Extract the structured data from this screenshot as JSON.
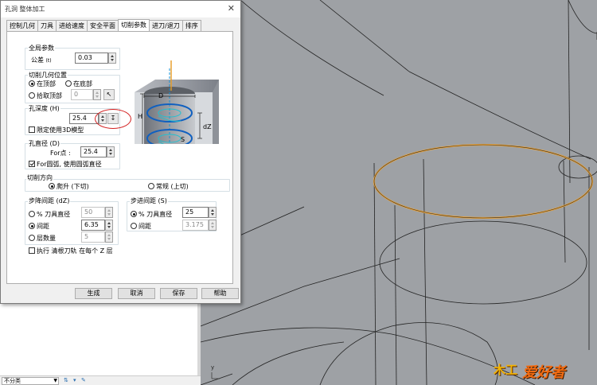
{
  "dialog": {
    "title": "孔洞 整体加工",
    "tabs": [
      "控制几何",
      "刀具",
      "进给速度",
      "安全平面",
      "切削参数",
      "进刀/退刀",
      "排序"
    ],
    "active_tab": 4,
    "global_params": {
      "label": "全局参数",
      "tolerance_label": "公差",
      "tolerance_value": "0.03"
    },
    "geometry_position": {
      "label": "切削几何位置",
      "top_label": "在顶部",
      "bottom_label": "在底部",
      "pick_top_label": "拾取顶部",
      "pick_value": "0",
      "selected": "top"
    },
    "hole_depth": {
      "label": "孔深度 (H)",
      "value": "25.4",
      "limit_label": "限定使用3D模型",
      "limit_checked": false
    },
    "hole_diameter": {
      "label": "孔直径 (D)",
      "for_point_label": "For点 :",
      "for_point_value": "25.4",
      "for_circle_label": "For圆弧, 使用圆弧直径",
      "for_circle_checked": true
    },
    "cut_direction": {
      "label": "切削方向",
      "climb_label": "爬升 (下切)",
      "conventional_label": "常规 (上切)",
      "selected": "climb"
    },
    "stepdown": {
      "label": "步降间距 (dZ)",
      "pct_label": "% 刀具直径",
      "pct_value": "50",
      "spacing_label": "间距",
      "spacing_value": "6.35",
      "layers_label": "层数量",
      "layers_value": "5",
      "selected": "spacing",
      "finish_label": "执行 清根刀轨 在每个 Z 层",
      "finish_checked": false
    },
    "stepover": {
      "label": "步进间距 (S)",
      "pct_label": "% 刀具直径",
      "pct_value": "25",
      "spacing_label": "间距",
      "spacing_value": "3.175",
      "selected": "pct"
    },
    "buttons": {
      "generate": "生成",
      "cancel": "取消",
      "save": "保存",
      "help": "帮助"
    },
    "diagram_labels": {
      "D": "D",
      "H": "H",
      "dZ": "dZ",
      "S": "S"
    }
  },
  "bottom_bar": {
    "dropdown_value": "不分类"
  },
  "viewport": {
    "axis_label": "y",
    "selected_curve_color": "#e8a33c",
    "background_color": "#9ea1a5"
  },
  "logo": {
    "mark": "木工",
    "text": "爱好者"
  }
}
